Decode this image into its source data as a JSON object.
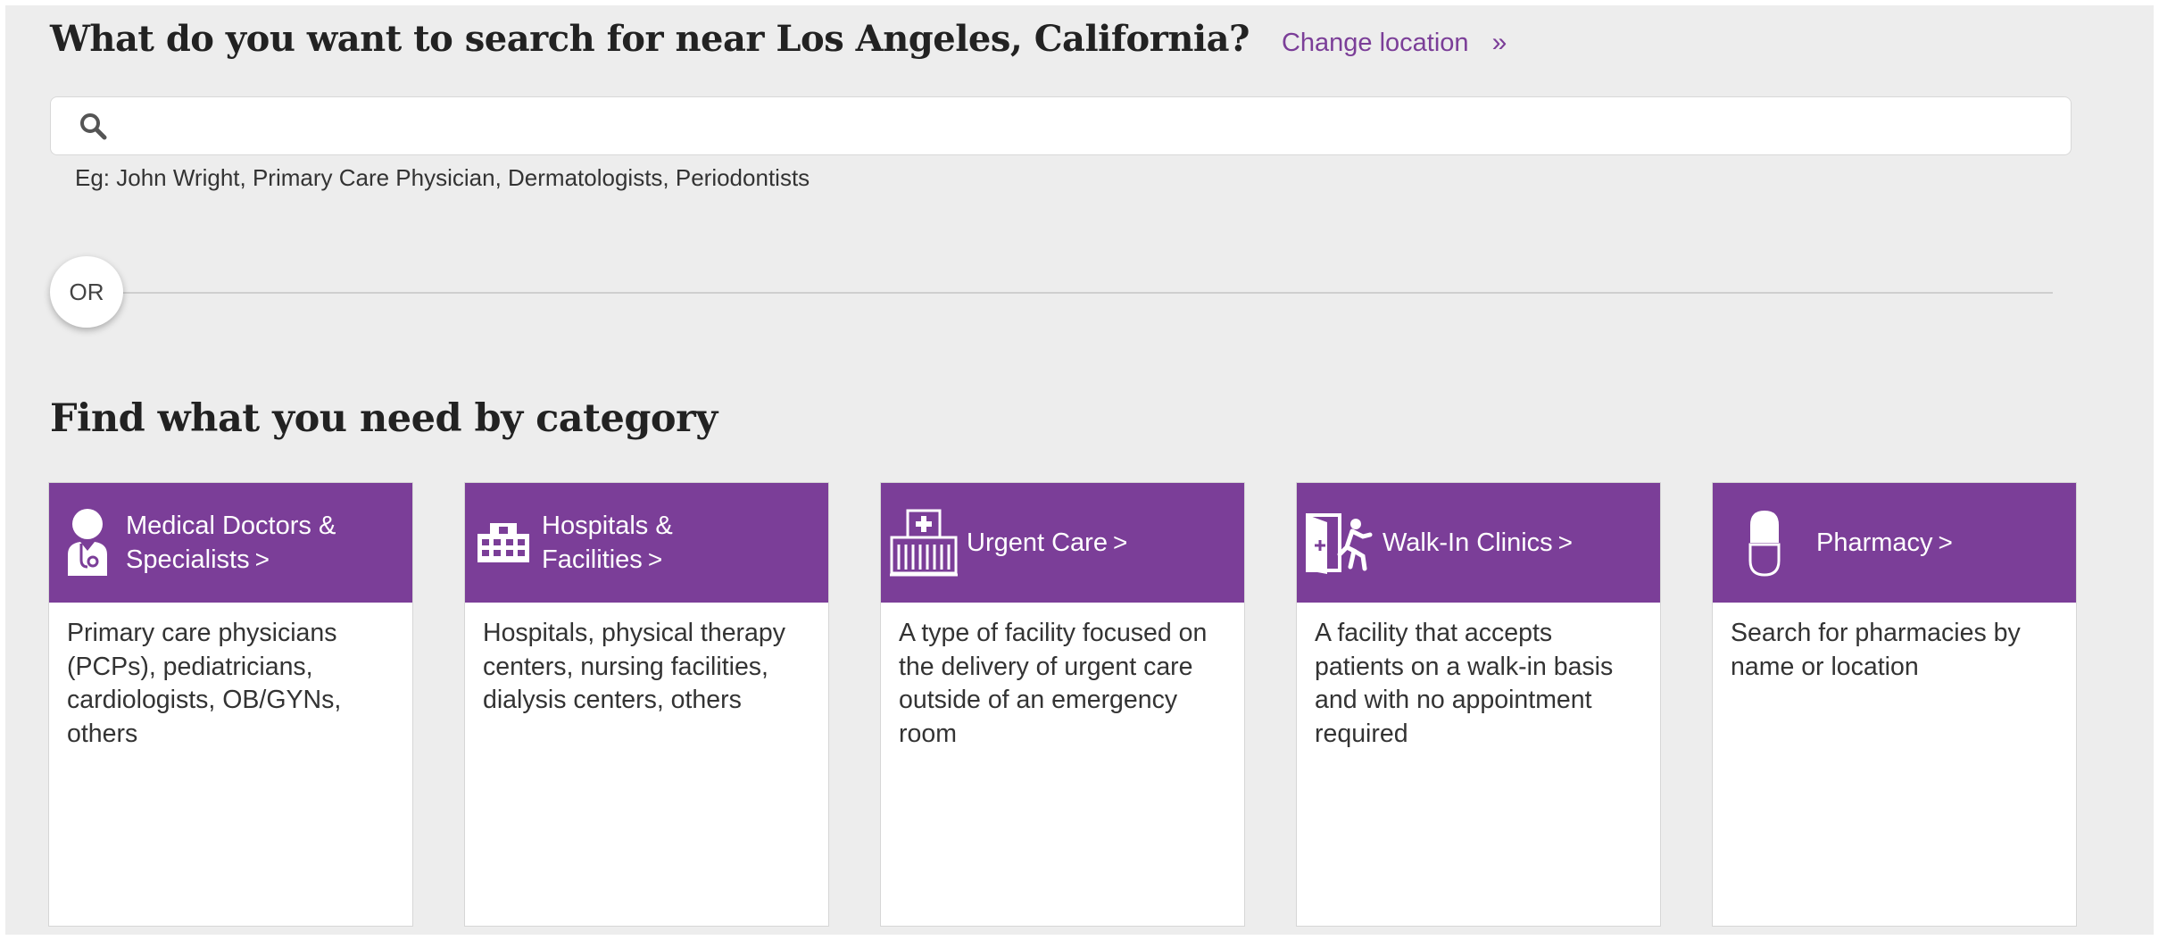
{
  "header": {
    "title": "What do you want to search for near Los Angeles, California?",
    "change_location": "Change location",
    "change_location_chevron": "»"
  },
  "search": {
    "value": "",
    "placeholder": "",
    "hint": "Eg: John Wright, Primary Care Physician, Dermatologists, Periodontists"
  },
  "divider": {
    "or_label": "OR"
  },
  "categories": {
    "title": "Find what you need by category",
    "accent_color": "#7b3e98",
    "items": [
      {
        "icon": "doctor-icon",
        "label_line1": "Medical Doctors &",
        "label_line2": "Specialists",
        "arrow": ">",
        "description": "Primary care physicians (PCPs), pediatricians, cardiologists, OB/GYNs, others"
      },
      {
        "icon": "hospital-building-icon",
        "label_line1": "Hospitals &",
        "label_line2": "Facilities",
        "arrow": ">",
        "description": "Hospitals, physical therapy centers, nursing facilities, dialysis centers, others"
      },
      {
        "icon": "urgent-care-icon",
        "label_line1": "Urgent Care",
        "label_line2": "",
        "arrow": ">",
        "description": "A type of facility focused on the delivery of urgent care outside of an emergency room"
      },
      {
        "icon": "walk-in-clinic-icon",
        "label_line1": "Walk-In Clinics",
        "label_line2": "",
        "arrow": ">",
        "description": "A facility that accepts patients on a walk-in basis and with no appointment required"
      },
      {
        "icon": "pill-icon",
        "label_line1": "Pharmacy",
        "label_line2": "",
        "arrow": ">",
        "description": "Search for pharmacies by name or location"
      }
    ]
  }
}
